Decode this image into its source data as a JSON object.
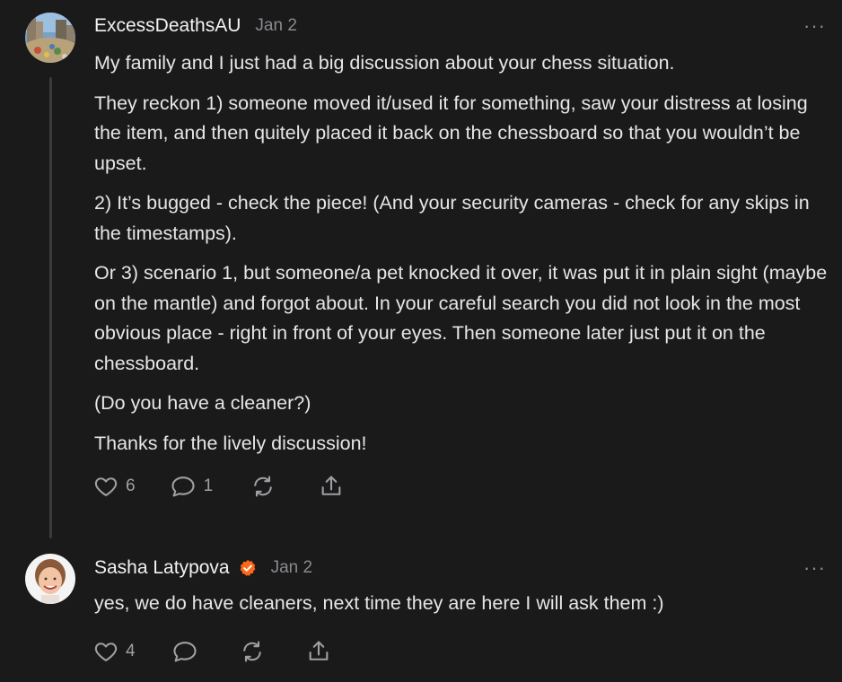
{
  "comments": [
    {
      "author": "ExcessDeathsAU",
      "date": "Jan 2",
      "verified": false,
      "paragraphs": [
        "My family and I just had a big discussion about your chess situation.",
        "They reckon 1) someone moved it/used it for something, saw your distress at losing the item, and then quitely placed it back on the chessboard so that you wouldn’t be upset.",
        "2) It’s bugged - check the piece! (And your security cameras - check for any skips in the timestamps).",
        "Or 3) scenario 1, but someone/a pet knocked it over, it was put it in plain sight (maybe on the mantle) and forgot about. In your careful search you did not look in the most obvious place - right in front of your eyes. Then someone later just put it on the chessboard.",
        "(Do you have a cleaner?)",
        "Thanks for the lively discussion!"
      ],
      "likes": "6",
      "replies": "1",
      "more_label": "···"
    },
    {
      "author": "Sasha Latypova",
      "date": "Jan 2",
      "verified": true,
      "paragraphs": [
        "yes, we do have cleaners, next time they are here I will ask them :)"
      ],
      "likes": "4",
      "replies": "",
      "more_label": "···"
    }
  ],
  "colors": {
    "background": "#1a1a1b",
    "verified_badge": "#ff6719",
    "muted_text": "#8a8a8e"
  },
  "icons": [
    "heart-icon",
    "comment-icon",
    "restack-icon",
    "share-icon",
    "more-icon",
    "verified-icon"
  ]
}
